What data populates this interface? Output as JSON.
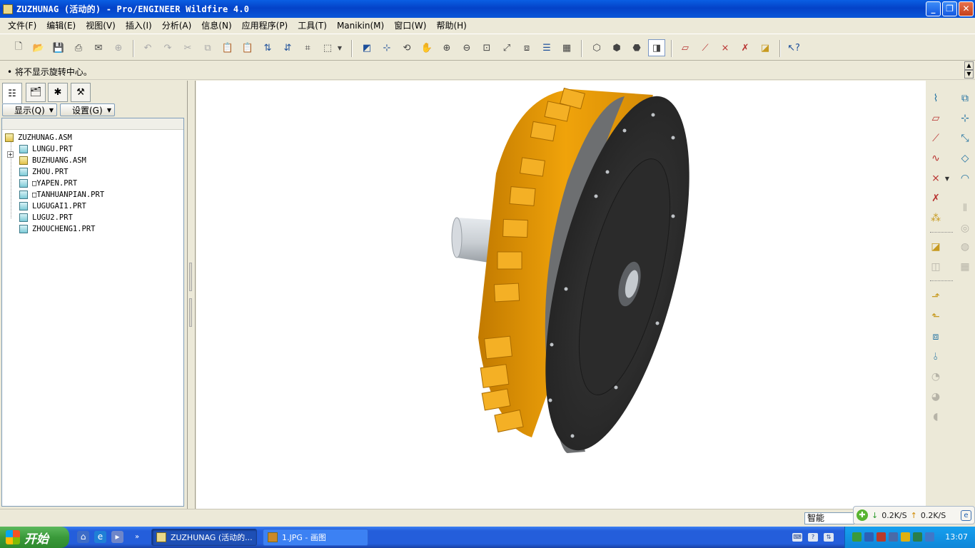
{
  "window": {
    "title": "ZUZHUNAG (活动的) - Pro/ENGINEER Wildfire 4.0",
    "controls": [
      "_",
      "❐",
      "✕"
    ]
  },
  "menu": [
    "文件(F)",
    "编辑(E)",
    "视图(V)",
    "插入(I)",
    "分析(A)",
    "信息(N)",
    "应用程序(P)",
    "工具(T)",
    "Manikin(M)",
    "窗口(W)",
    "帮助(H)"
  ],
  "message_area": {
    "text": "• 将不显示旋转中心。"
  },
  "nav_panel": {
    "show_button": "显示(Q)",
    "settings_button": "设置(G)",
    "tree": [
      {
        "label": "ZUZHUNAG.ASM",
        "type": "asm"
      },
      {
        "label": "LUNGU.PRT",
        "type": "prt"
      },
      {
        "label": "BUZHUANG.ASM",
        "type": "asm"
      },
      {
        "label": "ZHOU.PRT",
        "type": "prt"
      },
      {
        "label": "□YAPEN.PRT",
        "type": "prt"
      },
      {
        "label": "□TANHUANPIAN.PRT",
        "type": "prt"
      },
      {
        "label": "LUGUGAI1.PRT",
        "type": "prt"
      },
      {
        "label": "LUGU2.PRT",
        "type": "prt"
      },
      {
        "label": "ZHOUCHENG1.PRT",
        "type": "prt"
      }
    ]
  },
  "status": {
    "filter": "智能"
  },
  "net_speed": {
    "down": "0.2K/S",
    "up": "0.2K/S"
  },
  "taskbar": {
    "start": "开始",
    "tasks": [
      {
        "label": "ZUZHUNAG (活动的...",
        "active": true
      },
      {
        "label": "1.JPG - 画图",
        "active": false
      }
    ],
    "clock": "13:07"
  },
  "colors": {
    "gear_orange": "#f0a30a",
    "disk_dark": "#2e2e2e",
    "shaft_gray": "#c9ced3",
    "title_blue": "#0a56d8"
  }
}
